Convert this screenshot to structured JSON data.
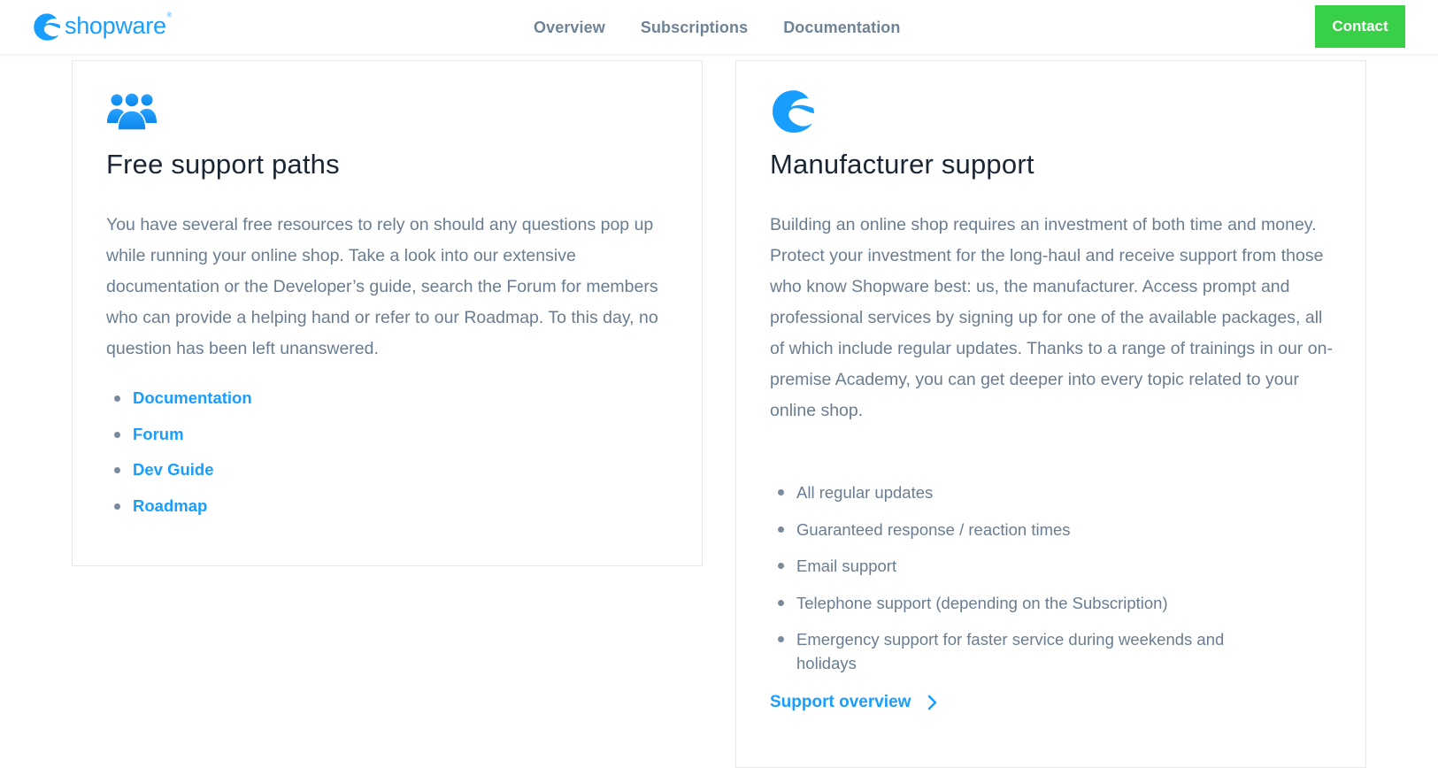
{
  "header": {
    "logo_text": "shopware",
    "logo_reg": "®",
    "nav": [
      {
        "label": "Overview"
      },
      {
        "label": "Subscriptions"
      },
      {
        "label": "Documentation"
      }
    ],
    "contact_label": "Contact"
  },
  "colors": {
    "brand_blue": "#189eff",
    "contact_green": "#37d046",
    "title_dark": "#1a2633",
    "body_text": "#6a7d90",
    "nav_text": "#6f8396"
  },
  "free_support": {
    "icon": "users-group-icon",
    "title": "Free support paths",
    "text": "You have several free resources to rely on should any questions pop up while running your online shop. Take a look into our extensive documentation or the Developer’s guide, search the Forum for members who can provide a helping hand or refer to our Roadmap. To this day, no question has been left unanswered.",
    "links": [
      {
        "label": "Documentation"
      },
      {
        "label": "Forum"
      },
      {
        "label": "Dev Guide"
      },
      {
        "label": "Roadmap"
      }
    ]
  },
  "manufacturer_support": {
    "icon": "shopware-logo-icon",
    "title": "Manufacturer support",
    "text": "Building an online shop requires an investment of both time and money. Protect your investment for the long-haul and receive support from those who know Shopware best: us, the manufacturer. Access prompt and professional services by signing up for one of the available packages, all of which include regular updates. Thanks to a range of trainings in our on-premise Academy, you can get deeper into every topic related to your online shop.",
    "features": [
      {
        "label": "All regular updates"
      },
      {
        "label": "Guaranteed response / reaction times"
      },
      {
        "label": "Email support"
      },
      {
        "label": "Telephone support (depending on the Subscription)"
      },
      {
        "label": "Emergency support for faster service during weekends and holidays"
      }
    ],
    "cta_label": "Support overview",
    "cta_icon": "chevron-right-icon"
  }
}
